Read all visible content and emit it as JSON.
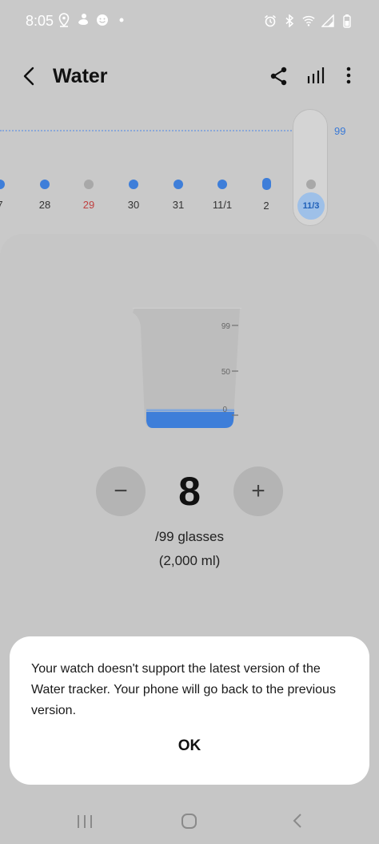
{
  "status_bar": {
    "time": "8:05",
    "left_icons": [
      "location-icon",
      "person-icon",
      "smiley-icon",
      "dot-icon"
    ],
    "right_icons": [
      "alarm-icon",
      "bluetooth-icon",
      "wifi-icon",
      "signal-icon",
      "battery-icon"
    ]
  },
  "app_bar": {
    "title": "Water",
    "icons": [
      "back-arrow-icon",
      "share-icon",
      "stats-bars-icon",
      "more-vertical-icon"
    ]
  },
  "date_strip": {
    "max_label": "99",
    "days": [
      {
        "label": "7",
        "dot": "blue"
      },
      {
        "label": "28",
        "dot": "blue"
      },
      {
        "label": "29",
        "dot": "grey",
        "label_color": "red"
      },
      {
        "label": "30",
        "dot": "blue"
      },
      {
        "label": "31",
        "dot": "blue"
      },
      {
        "label": "11/1",
        "dot": "blue"
      },
      {
        "label": "2",
        "dot": "blue-tall"
      },
      {
        "label": "11/3",
        "dot": "grey",
        "selected": true
      }
    ]
  },
  "cup": {
    "scale_labels": [
      "99",
      "50",
      "0"
    ],
    "fill_fraction": 0.08
  },
  "counter": {
    "minus_label": "−",
    "value": "8",
    "plus_label": "+",
    "goal_text": "/99 glasses",
    "ml_text": "(2,000 ml)"
  },
  "dialog": {
    "message": "Your watch doesn't support the latest version of the Water tracker. Your phone will go back to the previous version.",
    "ok_label": "OK"
  },
  "nav_bar": {
    "icons": [
      "recent-apps-icon",
      "home-icon",
      "back-icon"
    ]
  },
  "colors": {
    "accent_blue": "#3e7ed9",
    "weekend_red": "#c04040",
    "background": "#c9c9c9",
    "dialog": "#ffffff"
  }
}
